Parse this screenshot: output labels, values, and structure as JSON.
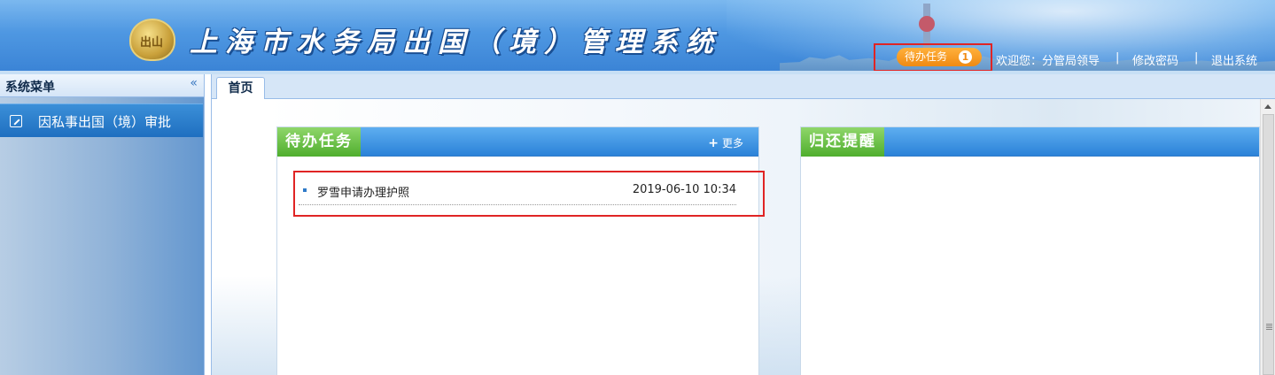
{
  "header": {
    "logo_text": "出山",
    "system_title": "上海市水务局出国（境）管理系统",
    "pending_tasks_label": "待办任务",
    "pending_tasks_count": "1",
    "welcome_text": "欢迎您：分管局领导",
    "separator": "|",
    "change_password": "修改密码",
    "logout": "退出系统"
  },
  "sidebar": {
    "title": "系统菜单",
    "collapse_icon": "«",
    "items": [
      {
        "label": "因私事出国（境）审批",
        "icon": "edit-icon"
      }
    ]
  },
  "tabs": [
    {
      "label": "首页"
    }
  ],
  "panels": {
    "pending": {
      "title": "待办任务",
      "more_label": "更多",
      "more_icon": "+",
      "tasks": [
        {
          "name": "罗雪申请办理护照",
          "time": "2019-06-10 10:34"
        }
      ]
    },
    "reminder": {
      "title": "归还提醒"
    }
  },
  "colors": {
    "header_blue": "#4f98e2",
    "menu_active": "#1f6fc0",
    "panel_title_green": "#4fae2e",
    "highlight_red": "#e02424",
    "task_orange": "#f08a12"
  }
}
